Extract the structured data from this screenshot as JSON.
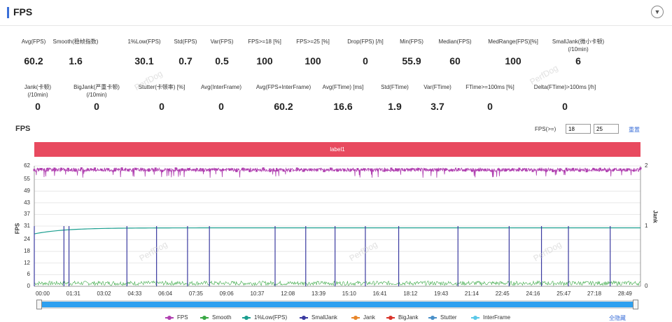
{
  "header": {
    "title": "FPS",
    "collapse_icon": "chevron-down-icon"
  },
  "stats_row1": [
    {
      "label": "Avg(FPS)",
      "value": "60.2"
    },
    {
      "label": "Smooth(稳帧指数)",
      "value": "1.6"
    },
    {
      "label": "1%Low(FPS)",
      "value": "30.1"
    },
    {
      "label": "Std(FPS)",
      "value": "0.7"
    },
    {
      "label": "Var(FPS)",
      "value": "0.5"
    },
    {
      "label": "FPS>=18 [%]",
      "value": "100"
    },
    {
      "label": "FPS>=25 [%]",
      "value": "100"
    },
    {
      "label": "Drop(FPS) [/h]",
      "value": "0"
    },
    {
      "label": "Min(FPS)",
      "value": "55.9"
    },
    {
      "label": "Median(FPS)",
      "value": "60"
    },
    {
      "label": "MedRange(FPS)[%]",
      "value": "100"
    },
    {
      "label": "SmallJank(微小卡顿)",
      "label2": "(/10min)",
      "value": "6"
    }
  ],
  "stats_row2": [
    {
      "label": "Jank(卡顿)",
      "label2": "(/10min)",
      "value": "0"
    },
    {
      "label": "BigJank(严重卡顿)",
      "label2": "(/10min)",
      "value": "0"
    },
    {
      "label": "Stutter(卡顿率) [%]",
      "value": "0"
    },
    {
      "label": "Avg(InterFrame)",
      "value": "0"
    },
    {
      "label": "Avg(FPS+InterFrame)",
      "value": "60.2"
    },
    {
      "label": "Avg(FTime) [ms]",
      "value": "16.6"
    },
    {
      "label": "Std(FTime)",
      "value": "1.9"
    },
    {
      "label": "Var(FTime)",
      "value": "3.7"
    },
    {
      "label": "FTime>=100ms [%]",
      "value": "0"
    },
    {
      "label": "Delta(FTime)>100ms [/h]",
      "value": "0"
    }
  ],
  "chart_header": {
    "title": "FPS",
    "threshold_label": "FPS(>=)",
    "threshold_1": "18",
    "threshold_2": "25",
    "reset_label": "重置"
  },
  "label_banner": "label1",
  "watermark": "PerfDog",
  "chart_data": {
    "type": "line",
    "ylabel": "FPS",
    "y2label": "Jank",
    "ylim": [
      0,
      62
    ],
    "y2lim": [
      0,
      2
    ],
    "y_ticks": [
      "62",
      "55",
      "49",
      "43",
      "37",
      "31",
      "24",
      "18",
      "12",
      "6",
      "0"
    ],
    "y2_ticks": [
      "2",
      "1",
      "0"
    ],
    "x_ticks": [
      "00:00",
      "01:31",
      "03:02",
      "04:33",
      "06:04",
      "07:35",
      "09:06",
      "10:37",
      "12:08",
      "13:39",
      "15:10",
      "16:41",
      "18:12",
      "19:43",
      "21:14",
      "22:45",
      "24:16",
      "25:47",
      "27:18",
      "28:49"
    ],
    "duration_s": 1800,
    "series": [
      {
        "name": "FPS",
        "color": "#b03fb0",
        "approx_value": 60,
        "range": [
          55.9,
          62
        ]
      },
      {
        "name": "Smooth",
        "color": "#3aa845",
        "approx_value": 1.6
      },
      {
        "name": "1%Low(FPS)",
        "color": "#1a9e8f",
        "start": 27,
        "steady": 30.1
      },
      {
        "name": "SmallJank",
        "color": "#3a3aa0",
        "events_s": [
          0,
          88,
          103,
          275,
          363,
          455,
          520,
          715,
          806,
          893,
          983,
          1082,
          1258,
          1410,
          1506,
          1586,
          1710
        ]
      },
      {
        "name": "Jank",
        "color": "#e8862a"
      },
      {
        "name": "BigJank",
        "color": "#d9342b"
      },
      {
        "name": "Stutter",
        "color": "#4a90c8"
      },
      {
        "name": "InterFrame",
        "color": "#5bc8e8"
      }
    ]
  },
  "legend_hide_all": "全隐藏"
}
